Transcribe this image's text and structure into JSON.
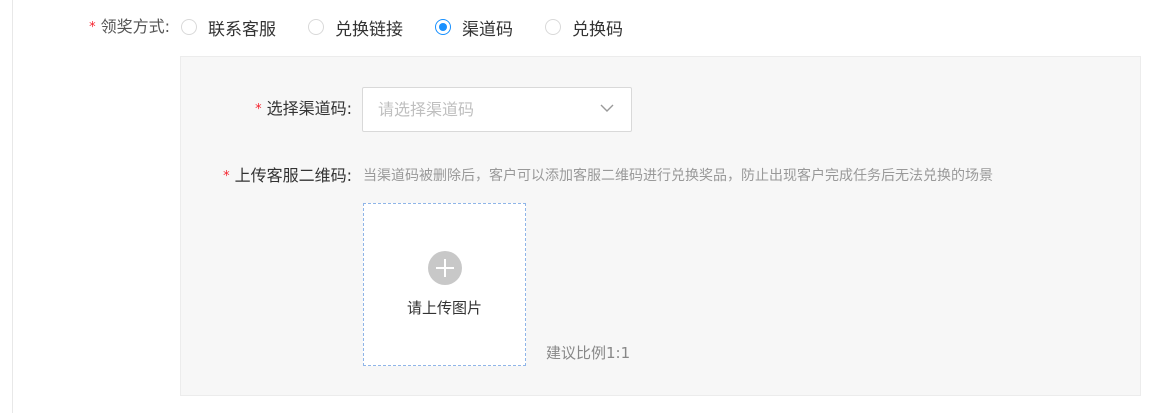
{
  "prize_method": {
    "label": "领奖方式:",
    "options": [
      {
        "label": "联系客服",
        "checked": false
      },
      {
        "label": "兑换链接",
        "checked": false
      },
      {
        "label": "渠道码",
        "checked": true
      },
      {
        "label": "兑换码",
        "checked": false
      }
    ]
  },
  "channel_code": {
    "label": "选择渠道码:",
    "placeholder": "请选择渠道码"
  },
  "service_qr": {
    "label": "上传客服二维码:",
    "hint": "当渠道码被删除后，客户可以添加客服二维码进行兑换奖品，防止出现客户完成任务后无法兑换的场景",
    "upload_label": "请上传图片",
    "ratio_note": "建议比例1:1"
  },
  "required_mark": "*",
  "colors": {
    "accent": "#1890ff",
    "required": "#f5222d",
    "panel_bg": "#f7f7f7"
  }
}
